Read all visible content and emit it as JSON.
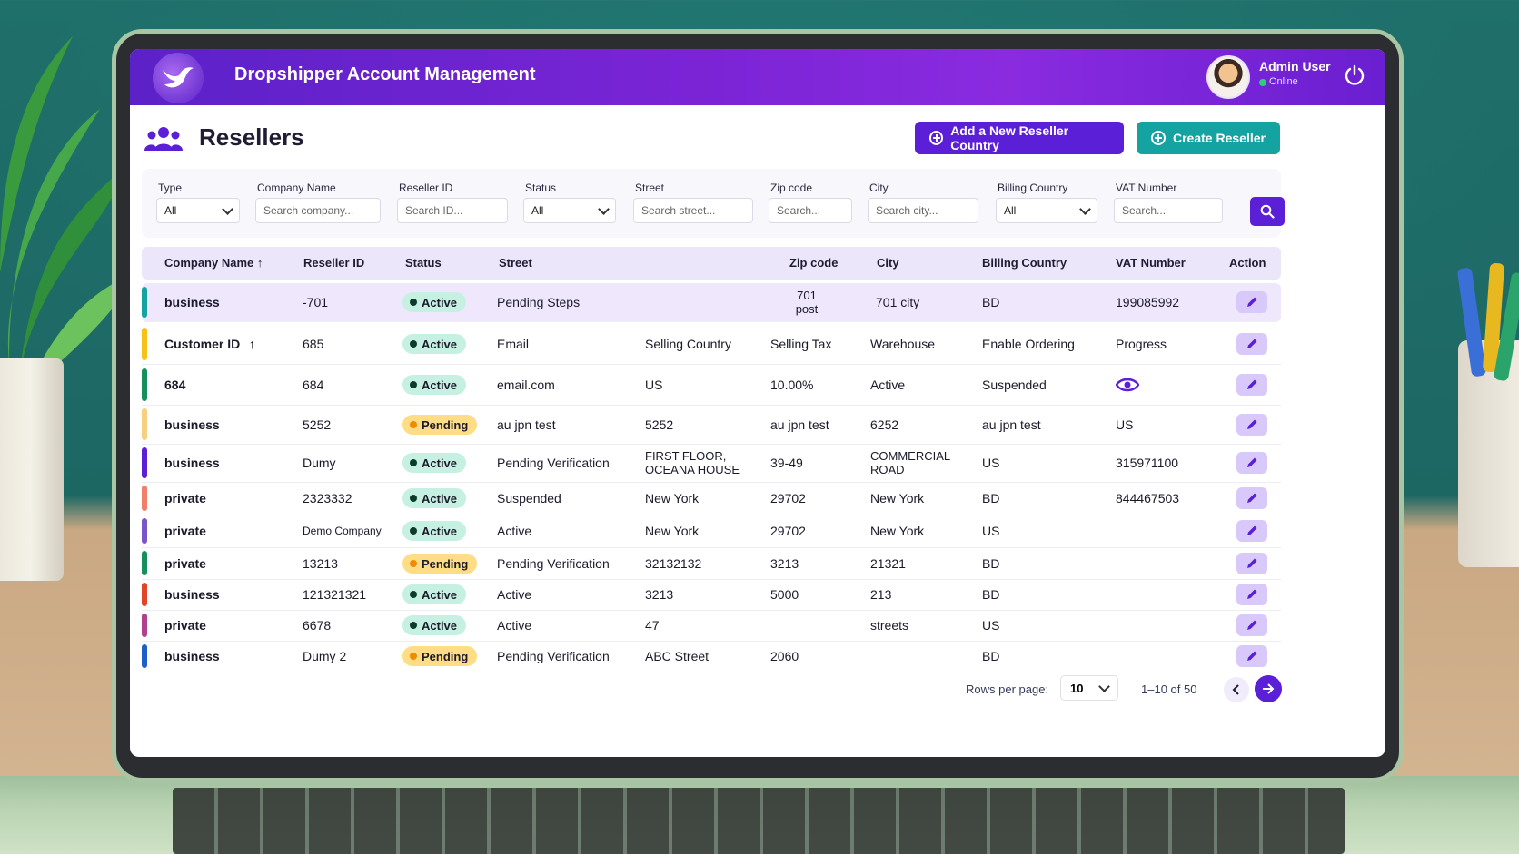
{
  "app": {
    "title": "Dropshipper Account Management"
  },
  "user": {
    "name": "Admin User",
    "status": "Online"
  },
  "page": {
    "title": "Resellers"
  },
  "actions": {
    "add_country": "Add a New Reseller Country",
    "create": "Create Reseller"
  },
  "filters": {
    "type": {
      "label": "Type",
      "value": "All"
    },
    "company": {
      "label": "Company Name",
      "placeholder": "Search company..."
    },
    "reseller_id": {
      "label": "Reseller ID",
      "placeholder": "Search ID..."
    },
    "status": {
      "label": "Status",
      "value": "All"
    },
    "street": {
      "label": "Street",
      "placeholder": "Search street..."
    },
    "zip": {
      "label": "Zip code",
      "placeholder": "Search..."
    },
    "city": {
      "label": "City",
      "placeholder": "Search city..."
    },
    "billing": {
      "label": "Billing Country",
      "value": "All"
    },
    "vat": {
      "label": "VAT Number",
      "placeholder": "Search..."
    }
  },
  "table": {
    "headers": [
      "Company Name",
      "Reseller ID",
      "Status",
      "Street",
      "Zip code",
      "City",
      "Billing Country",
      "VAT Number",
      "Action"
    ],
    "sort_arrow": "↑",
    "rows": [
      {
        "c0": "business",
        "c1": "-701",
        "status": "Active",
        "c3": "Pending Steps",
        "c4": "",
        "c5": "701\npost",
        "c6": "701 city",
        "c7": "BD",
        "c8": "199085992",
        "color": "#14a3a0"
      },
      {
        "c0": "Customer ID",
        "c1": "685",
        "status": "Active",
        "c3": "Email",
        "c4": "Selling Country",
        "c5": "Selling Tax",
        "c6": "Warehouse",
        "c7": "Enable Ordering",
        "c8": "Progress",
        "color": "#f6c21a"
      },
      {
        "c0": "684",
        "c1": "684",
        "status": "Active",
        "c3": "email.com",
        "c4": "US",
        "c5": "10.00%",
        "c6": "Active",
        "c7": "Suspended",
        "c8": "",
        "color": "#178f5c"
      },
      {
        "c0": "business",
        "c1": "5252",
        "status": "Pending",
        "c3": "au jpn test",
        "c4": "5252",
        "c5": "au jpn test",
        "c6": "6252",
        "c7": "au jpn test",
        "c8": "US",
        "color": "#f7cf80"
      },
      {
        "c0": "business",
        "c1": "Dumy",
        "status": "Active",
        "c3": "Pending Verification",
        "c4": "FIRST FLOOR, OCEANA HOUSE",
        "c5": "39-49",
        "c6": "COMMERCIAL ROAD",
        "c7": "US",
        "c8": "315971100",
        "color": "#5a1fd6"
      },
      {
        "c0": "private",
        "c1": "2323332",
        "status": "Active",
        "c3": "Suspended",
        "c4": "New York",
        "c5": "29702",
        "c6": "New York",
        "c7": "BD",
        "c8": "844467503",
        "color": "#ef7f6a"
      },
      {
        "c0": "private",
        "c1": "Demo Company",
        "status": "Active",
        "c3": "Active",
        "c4": "New York",
        "c5": "29702",
        "c6": "New York",
        "c7": "US",
        "c8": "",
        "color": "#7a55c8"
      },
      {
        "c0": "private",
        "c1": "13213",
        "status": "Pending",
        "c3": "Pending Verification",
        "c4": "32132132",
        "c5": "3213",
        "c6": "21321",
        "c7": "BD",
        "c8": "",
        "color": "#178f5c"
      },
      {
        "c0": "business",
        "c1": "121321321",
        "status": "Active",
        "c3": "Active",
        "c4": "3213",
        "c5": "5000",
        "c6": "213",
        "c7": "BD",
        "c8": "",
        "color": "#e2442a"
      },
      {
        "c0": "private",
        "c1": "6678",
        "status": "Active",
        "c3": "Active",
        "c4": "47",
        "c5": "",
        "c6": "streets",
        "c7": "US",
        "c8": "",
        "color": "#b1408f"
      },
      {
        "c0": "business",
        "c1": "Dumy 2",
        "status": "Pending",
        "c3": "Pending Verification",
        "c4": "ABC Street",
        "c5": "2060",
        "c6": "",
        "c7": "BD",
        "c8": "",
        "color": "#1f5fc8"
      }
    ]
  },
  "pagination": {
    "rows_label": "Rows per page:",
    "rows_value": "10",
    "range": "1–10 of 50"
  },
  "colors": {
    "primary": "#5a1fd6",
    "teal": "#14a3a0",
    "active_bg": "#c6f0e2",
    "active_dot": "#0b3b2d",
    "pending_bg": "#ffdd86",
    "pending_dot": "#f08a00"
  },
  "icons": {
    "brand": "dove-logo-icon",
    "people": "users-icon",
    "power": "power-icon",
    "search": "search-icon",
    "edit": "pencil-icon",
    "view": "eye-icon"
  }
}
